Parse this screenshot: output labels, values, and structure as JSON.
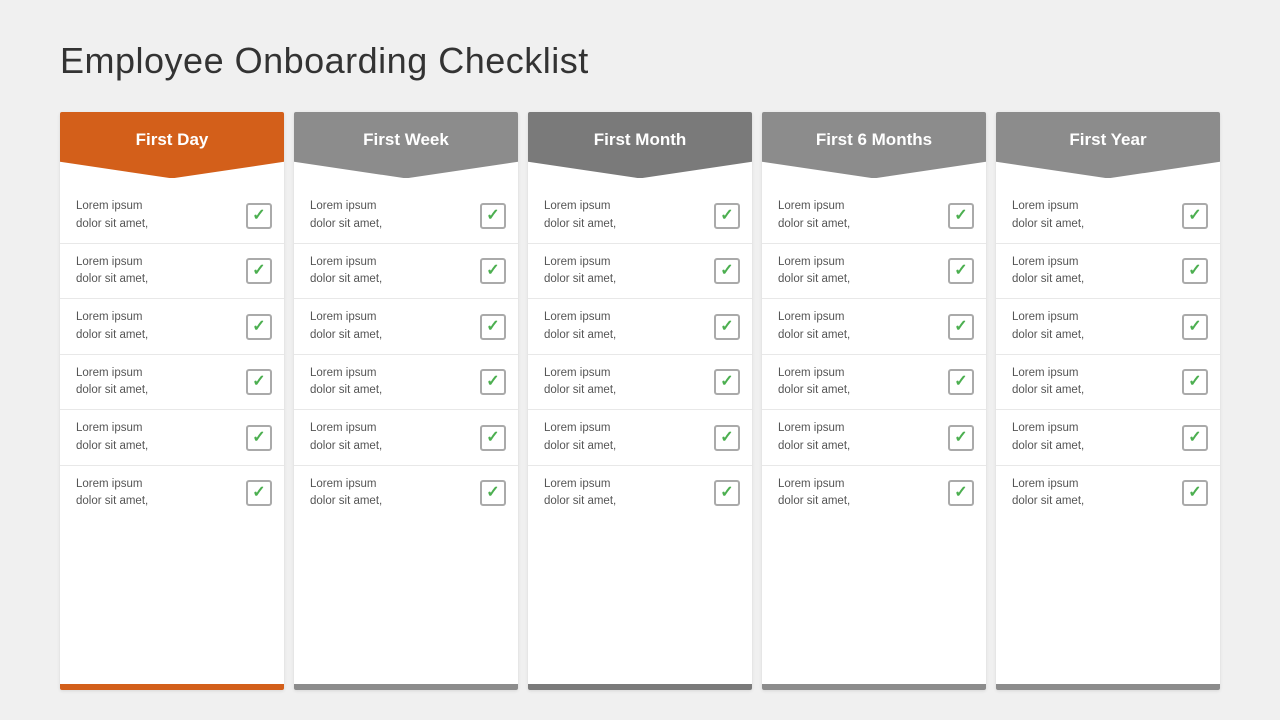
{
  "page": {
    "title": "Employee  Onboarding Checklist"
  },
  "columns": [
    {
      "id": "first-day",
      "header": "First Day",
      "color": "orange",
      "items": [
        {
          "text": "Lorem ipsum\ndolor sit amet,"
        },
        {
          "text": "Lorem ipsum\ndolor sit amet,"
        },
        {
          "text": "Lorem ipsum\ndolor sit amet,"
        },
        {
          "text": "Lorem ipsum\ndolor sit amet,"
        },
        {
          "text": "Lorem ipsum\ndolor sit amet,"
        },
        {
          "text": "Lorem ipsum\ndolor sit amet,"
        }
      ]
    },
    {
      "id": "first-week",
      "header": "First Week",
      "color": "gray1",
      "items": [
        {
          "text": "Lorem ipsum\ndolor sit amet,"
        },
        {
          "text": "Lorem ipsum\ndolor sit amet,"
        },
        {
          "text": "Lorem ipsum\ndolor sit amet,"
        },
        {
          "text": "Lorem ipsum\ndolor sit amet,"
        },
        {
          "text": "Lorem ipsum\ndolor sit amet,"
        },
        {
          "text": "Lorem ipsum\ndolor sit amet,"
        }
      ]
    },
    {
      "id": "first-month",
      "header": "First Month",
      "color": "gray2",
      "items": [
        {
          "text": "Lorem ipsum\ndolor sit amet,"
        },
        {
          "text": "Lorem ipsum\ndolor sit amet,"
        },
        {
          "text": "Lorem ipsum\ndolor sit amet,"
        },
        {
          "text": "Lorem ipsum\ndolor sit amet,"
        },
        {
          "text": "Lorem ipsum\ndolor sit amet,"
        },
        {
          "text": "Lorem ipsum\ndolor sit amet,"
        }
      ]
    },
    {
      "id": "first-6-months",
      "header": "First 6 Months",
      "color": "gray3",
      "items": [
        {
          "text": "Lorem ipsum\ndolor sit amet,"
        },
        {
          "text": "Lorem ipsum\ndolor sit amet,"
        },
        {
          "text": "Lorem ipsum\ndolor sit amet,"
        },
        {
          "text": "Lorem ipsum\ndolor sit amet,"
        },
        {
          "text": "Lorem ipsum\ndolor sit amet,"
        },
        {
          "text": "Lorem ipsum\ndolor sit amet,"
        }
      ]
    },
    {
      "id": "first-year",
      "header": "First Year",
      "color": "gray4",
      "items": [
        {
          "text": "Lorem ipsum\ndolor sit amet,"
        },
        {
          "text": "Lorem ipsum\ndolor sit amet,"
        },
        {
          "text": "Lorem ipsum\ndolor sit amet,"
        },
        {
          "text": "Lorem ipsum\ndolor sit amet,"
        },
        {
          "text": "Lorem ipsum\ndolor sit amet,"
        },
        {
          "text": "Lorem ipsum\ndolor sit amet,"
        }
      ]
    }
  ],
  "check_symbol": "✓"
}
